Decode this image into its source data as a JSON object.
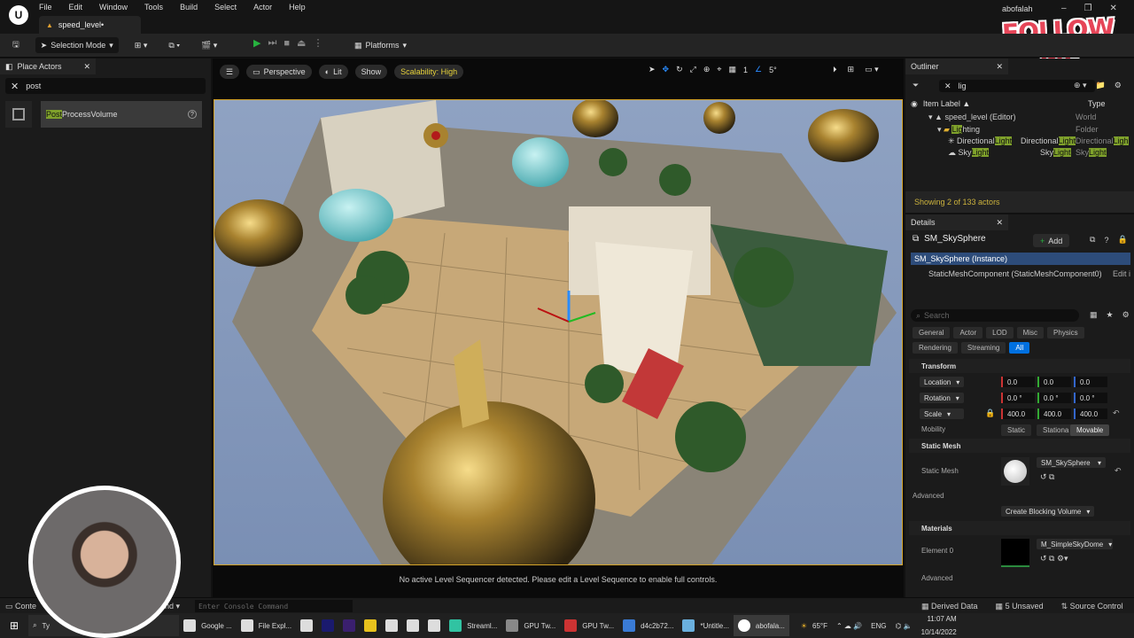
{
  "titlebar": {
    "menu": [
      "File",
      "Edit",
      "Window",
      "Tools",
      "Build",
      "Select",
      "Actor",
      "Help"
    ],
    "tab_label": "speed_level•",
    "user": "abofalah"
  },
  "toolbar": {
    "selection_mode": "Selection Mode",
    "platforms": "Platforms"
  },
  "overlay": {
    "follow_line1": "FOLLOW",
    "follow_line2": "ME"
  },
  "place_actors": {
    "tab": "Place Actors",
    "search_value": "post",
    "item_highlight": "Post",
    "item_rest": "ProcessVolume"
  },
  "viewport": {
    "perspective": "Perspective",
    "lit": "Lit",
    "show": "Show",
    "scalability": "Scalability: High",
    "grid_value": "1",
    "angle_value": "5°",
    "sequencer_msg": "No active Level Sequencer detected. Please edit a Level Sequence to enable full controls."
  },
  "outliner": {
    "tab": "Outliner",
    "search_value": "lig",
    "col_label": "Item Label ▲",
    "col_type": "Type",
    "rows": [
      {
        "label": "speed_level (Editor)",
        "type": "World",
        "extra": ""
      },
      {
        "label_pre": "",
        "label_hl": "Lig",
        "label_post": "hting",
        "type": "Folder",
        "extra": ""
      },
      {
        "label_pre": "Directional",
        "label_hl": "Light",
        "label_post": "",
        "type_pre": "Directional",
        "type_hl": "Light",
        "extra_pre": "Directional",
        "extra_hl": "Ligh"
      },
      {
        "label_pre": "Sky",
        "label_hl": "Light",
        "label_post": "",
        "type_pre": "Sky",
        "type_hl": "Light",
        "extra_pre": "Sky",
        "extra_hl": "Light"
      }
    ],
    "status": "Showing 2 of 133 actors"
  },
  "details": {
    "tab": "Details",
    "object_name": "SM_SkySphere",
    "add_label": "Add",
    "instance": "SM_SkySphere (Instance)",
    "component": "StaticMeshComponent (StaticMeshComponent0)",
    "edit_link": "Edit i",
    "search_placeholder": "Search",
    "categories_row1": [
      "General",
      "Actor",
      "LOD",
      "Misc",
      "Physics"
    ],
    "categories_row2": [
      "Rendering",
      "Streaming",
      "All"
    ],
    "transform": {
      "title": "Transform",
      "location_label": "Location",
      "location": [
        "0.0",
        "0.0",
        "0.0"
      ],
      "rotation_label": "Rotation",
      "rotation": [
        "0.0 °",
        "0.0 °",
        "0.0 °"
      ],
      "scale_label": "Scale",
      "scale": [
        "400.0",
        "400.0",
        "400.0"
      ],
      "mobility_label": "Mobility",
      "mobility_options": [
        "Static",
        "Stationa",
        "Movable"
      ]
    },
    "static_mesh": {
      "title": "Static Mesh",
      "label": "Static Mesh",
      "value": "SM_SkySphere",
      "advanced": "Advanced",
      "create_blocking": "Create Blocking Volume"
    },
    "materials": {
      "title": "Materials",
      "element_label": "Element 0",
      "value": "M_SimpleSkyDome",
      "advanced": "Advanced"
    }
  },
  "statusbar": {
    "content": "Conte",
    "cmd": "nd",
    "console_placeholder": "Enter Console Command",
    "derived": "Derived Data",
    "unsaved": "5 Unsaved",
    "source": "Source Control"
  },
  "taskbar": {
    "search_text": "Ty",
    "apps": [
      "Google ...",
      "File Expl...",
      "Streaml...",
      "GPU Tw...",
      "GPU Tw...",
      "d4c2b72...",
      "*Untitle...",
      "abofala..."
    ],
    "weather": "65°F",
    "lang": "ENG",
    "time": "11:07 AM",
    "date": "10/14/2022"
  },
  "colors": {
    "accent": "#0070e0",
    "highlight": "#7fa12b",
    "warning": "#e7d23a",
    "play": "#27b33f",
    "follow": "#e64558"
  }
}
